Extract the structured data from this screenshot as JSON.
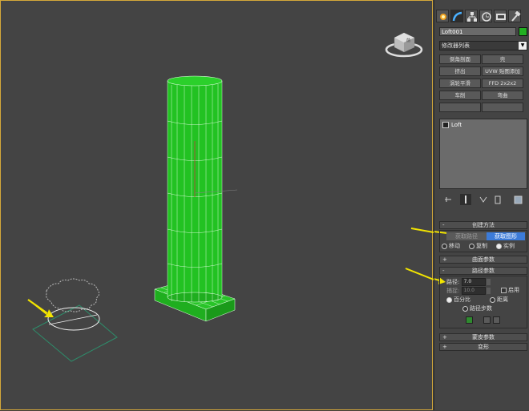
{
  "viewcube": {
    "label": "前"
  },
  "panel": {
    "object_name": "Loft001",
    "object_color": "#22b022",
    "modifier_list": "修改器列表",
    "modifier_buttons": [
      {
        "label": "倒角剖面"
      },
      {
        "label": "壳"
      },
      {
        "label": "挤出"
      },
      {
        "label": "UVW 贴图添加"
      },
      {
        "label": "涡轮平滑"
      },
      {
        "label": "FFD 2x2x2"
      },
      {
        "label": "车削"
      },
      {
        "label": "弯曲"
      },
      {
        "label": ""
      },
      {
        "label": ""
      }
    ],
    "stack_item": "Loft",
    "creation_method": {
      "title": "创建方法",
      "get_path": "获取路径",
      "get_shape": "获取图形",
      "radio_move": "移动",
      "radio_copy": "复制",
      "radio_instance": "实例"
    },
    "surface_params": {
      "title": "曲面参数"
    },
    "path_params": {
      "title": "路径参数",
      "path_label": "路径:",
      "path_value": "7.0",
      "snap_label": "捕捉:",
      "snap_value": "10.0",
      "enable_label": "启用",
      "percent_label": "百分比",
      "distance_label": "距离",
      "path_steps_label": "路径步数"
    },
    "skin_params": {
      "title": "蒙皮参数"
    },
    "deformation": {
      "title": "变形"
    }
  },
  "colors": {
    "accent_arrow": "#f2e400",
    "highlight": "#3c7bd8",
    "mesh": "#22c222"
  }
}
